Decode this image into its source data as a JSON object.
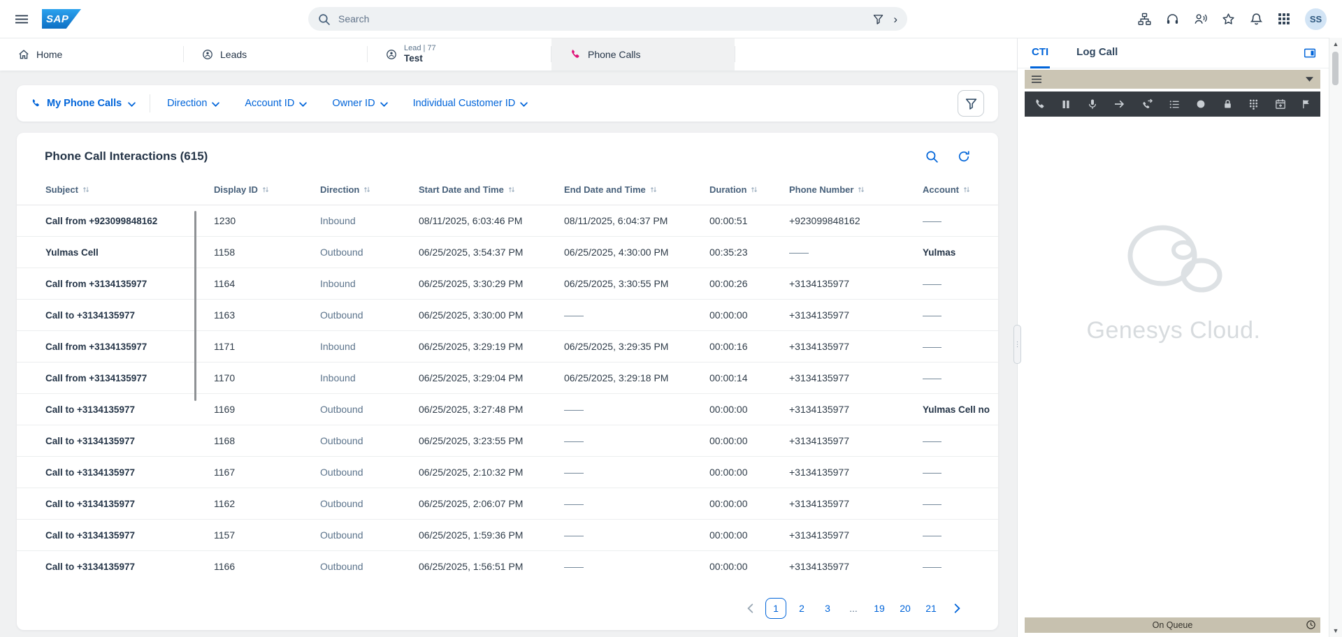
{
  "topbar": {
    "logo_text": "SAP",
    "search_placeholder": "Search",
    "avatar_initials": "SS"
  },
  "tabs": [
    {
      "label": "Home"
    },
    {
      "label": "Leads"
    },
    {
      "pre": "Lead | 77",
      "label": "Test"
    },
    {
      "label": "Phone Calls"
    }
  ],
  "filterbar": {
    "primary_label": "My Phone Calls",
    "filters": [
      "Direction",
      "Account ID",
      "Owner ID",
      "Individual Customer ID"
    ]
  },
  "list": {
    "title": "Phone Call Interactions (615)",
    "columns": [
      "Subject",
      "Display ID",
      "Direction",
      "Start Date and Time",
      "End Date and Time",
      "Duration",
      "Phone Number",
      "Account"
    ],
    "rows": [
      {
        "subject": "Call from +923099848162",
        "display_id": "1230",
        "direction": "Inbound",
        "start": "08/11/2025, 6:03:46 PM",
        "end": "08/11/2025, 6:04:37 PM",
        "duration": "00:00:51",
        "phone": "+923099848162",
        "account": "——"
      },
      {
        "subject": "Yulmas Cell",
        "display_id": "1158",
        "direction": "Outbound",
        "start": "06/25/2025, 3:54:37 PM",
        "end": "06/25/2025, 4:30:00 PM",
        "duration": "00:35:23",
        "phone": "——",
        "account": "Yulmas"
      },
      {
        "subject": "Call from +3134135977",
        "display_id": "1164",
        "direction": "Inbound",
        "start": "06/25/2025, 3:30:29 PM",
        "end": "06/25/2025, 3:30:55 PM",
        "duration": "00:00:26",
        "phone": "+3134135977",
        "account": "——"
      },
      {
        "subject": "Call to +3134135977",
        "display_id": "1163",
        "direction": "Outbound",
        "start": "06/25/2025, 3:30:00 PM",
        "end": "——",
        "duration": "00:00:00",
        "phone": "+3134135977",
        "account": "——"
      },
      {
        "subject": "Call from +3134135977",
        "display_id": "1171",
        "direction": "Inbound",
        "start": "06/25/2025, 3:29:19 PM",
        "end": "06/25/2025, 3:29:35 PM",
        "duration": "00:00:16",
        "phone": "+3134135977",
        "account": "——"
      },
      {
        "subject": "Call from +3134135977",
        "display_id": "1170",
        "direction": "Inbound",
        "start": "06/25/2025, 3:29:04 PM",
        "end": "06/25/2025, 3:29:18 PM",
        "duration": "00:00:14",
        "phone": "+3134135977",
        "account": "——"
      },
      {
        "subject": "Call to +3134135977",
        "display_id": "1169",
        "direction": "Outbound",
        "start": "06/25/2025, 3:27:48 PM",
        "end": "——",
        "duration": "00:00:00",
        "phone": "+3134135977",
        "account": "Yulmas Cell no"
      },
      {
        "subject": "Call to +3134135977",
        "display_id": "1168",
        "direction": "Outbound",
        "start": "06/25/2025, 3:23:55 PM",
        "end": "——",
        "duration": "00:00:00",
        "phone": "+3134135977",
        "account": "——"
      },
      {
        "subject": "Call to +3134135977",
        "display_id": "1167",
        "direction": "Outbound",
        "start": "06/25/2025, 2:10:32 PM",
        "end": "——",
        "duration": "00:00:00",
        "phone": "+3134135977",
        "account": "——"
      },
      {
        "subject": "Call to +3134135977",
        "display_id": "1162",
        "direction": "Outbound",
        "start": "06/25/2025, 2:06:07 PM",
        "end": "——",
        "duration": "00:00:00",
        "phone": "+3134135977",
        "account": "——"
      },
      {
        "subject": "Call to +3134135977",
        "display_id": "1157",
        "direction": "Outbound",
        "start": "06/25/2025, 1:59:36 PM",
        "end": "——",
        "duration": "00:00:00",
        "phone": "+3134135977",
        "account": "——"
      },
      {
        "subject": "Call to +3134135977",
        "display_id": "1166",
        "direction": "Outbound",
        "start": "06/25/2025, 1:56:51 PM",
        "end": "——",
        "duration": "00:00:00",
        "phone": "+3134135977",
        "account": "——"
      }
    ]
  },
  "pagination": {
    "pages": [
      "1",
      "2",
      "3",
      "...",
      "19",
      "20",
      "21"
    ],
    "current": "1"
  },
  "cti": {
    "tab_cti": "CTI",
    "tab_log": "Log Call",
    "watermark": "Genesys Cloud.",
    "status": "On Queue",
    "toolbar_icons": [
      "phone-icon",
      "pause-icon",
      "mic-icon",
      "arrow-right-icon",
      "transfer-call-icon",
      "list-icon",
      "record-icon",
      "lock-icon",
      "dialpad-icon",
      "schedule-icon",
      "flag-icon"
    ]
  },
  "icons": {
    "topbar": [
      "menu-icon",
      "search-icon",
      "filter-icon",
      "org-chart-icon",
      "headset-icon",
      "assistant-icon",
      "favorites-icon",
      "notifications-icon",
      "apps-icon"
    ]
  },
  "colors": {
    "accent_blue": "#0064d9",
    "phone_calls_pink": "#df1278",
    "cti_tan": "#cbc5b4",
    "cti_dark_toolbar": "#363b41"
  }
}
